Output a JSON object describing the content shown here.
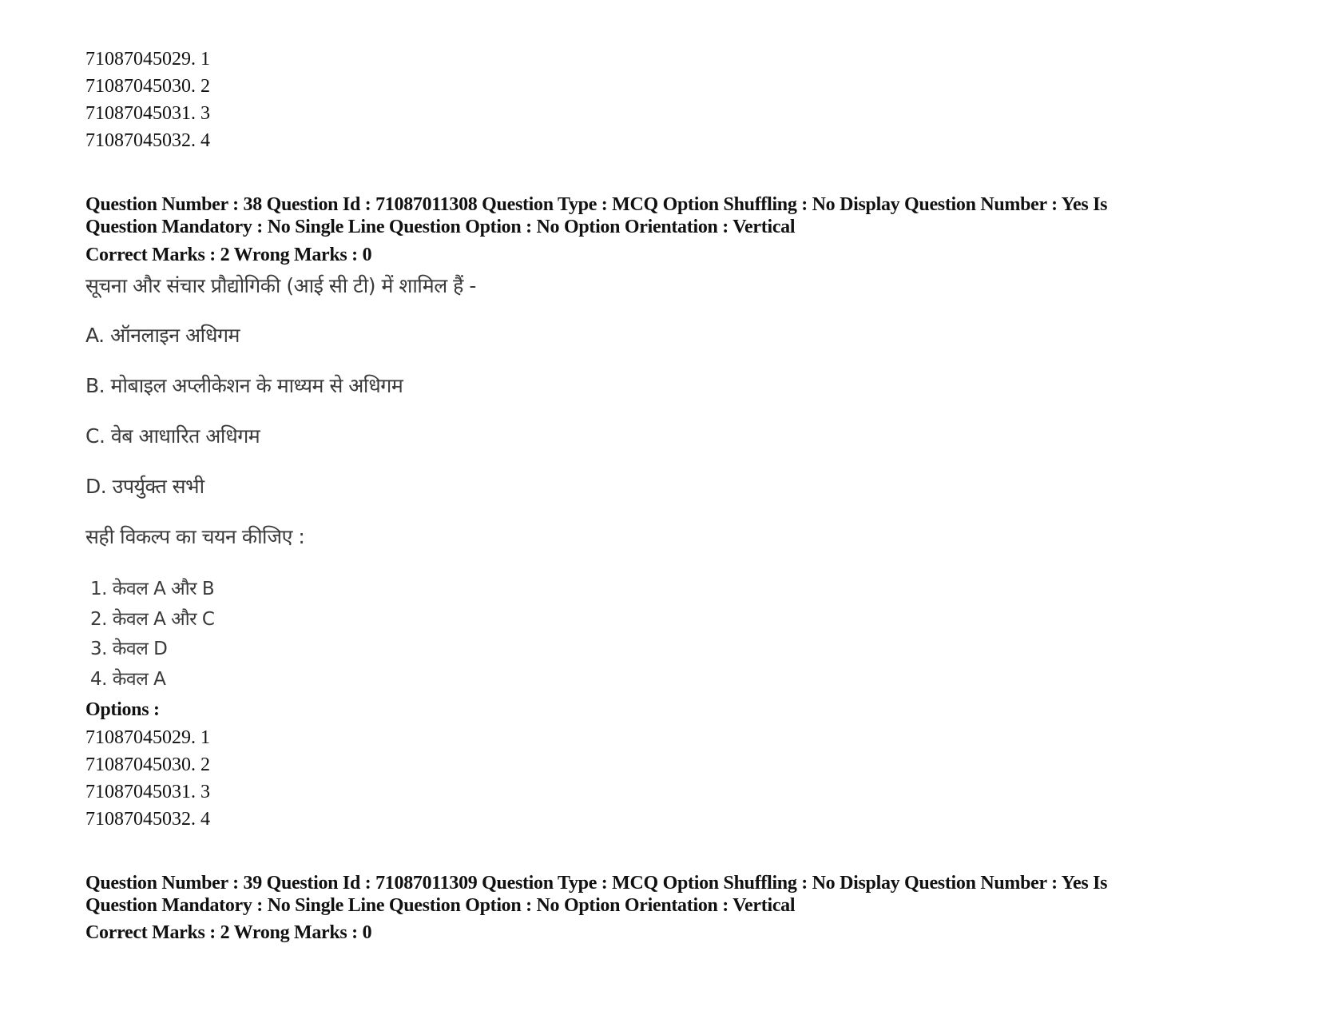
{
  "previous_options": [
    "71087045029. 1",
    "71087045030. 2",
    "71087045031. 3",
    "71087045032. 4"
  ],
  "question_38": {
    "header_line1": "Question Number : 38 Question Id : 71087011308 Question Type : MCQ Option Shuffling : No Display Question Number : Yes Is",
    "header_line2": "Question Mandatory : No Single Line Question Option : No Option Orientation : Vertical",
    "marks": "Correct Marks : 2 Wrong Marks : 0",
    "question_text": "सूचना और संचार प्रौद्योगिकी (आई सी टी) में शामिल हैं -",
    "statements": [
      "A. ऑनलाइन अधिगम",
      "B. मोबाइल अप्लीकेशन के माध्यम से अधिगम",
      "C. वेब आधारित अधिगम",
      "D. उपर्युक्त सभी"
    ],
    "instruction": "सही विकल्प का चयन कीजिए :",
    "choices": [
      "1. केवल A और B",
      "2. केवल A और C",
      "3. केवल D",
      "4. केवल A"
    ],
    "options_label": "Options :",
    "options": [
      "71087045029. 1",
      "71087045030. 2",
      "71087045031. 3",
      "71087045032. 4"
    ]
  },
  "question_39": {
    "header_line1": "Question Number : 39 Question Id : 71087011309 Question Type : MCQ Option Shuffling : No Display Question Number : Yes Is",
    "header_line2": "Question Mandatory : No Single Line Question Option : No Option Orientation : Vertical",
    "marks": "Correct Marks : 2 Wrong Marks : 0"
  }
}
